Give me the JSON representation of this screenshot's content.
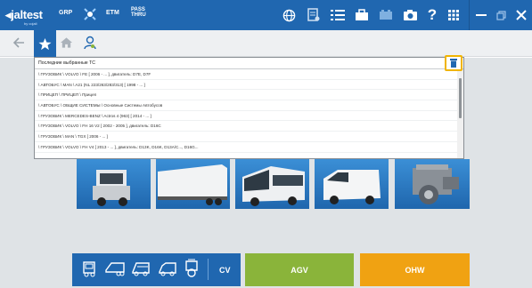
{
  "header": {
    "logo_prefix": "◂",
    "logo_text": "jaltest",
    "logo_sub": "by cojali",
    "nav": {
      "grp": "GRP",
      "etm": "ETM",
      "pass_line1": "PASS",
      "pass_line2": "THRU"
    },
    "icons": [
      "globe-icon",
      "document-icon",
      "list-icon",
      "briefcase-icon",
      "battery-icon",
      "camera-icon",
      "help-icon",
      "apps-grid-icon",
      "minimize-icon",
      "restore-icon",
      "close-icon"
    ]
  },
  "toolbar": {
    "back_icon": "arrow-left-icon",
    "tabs": [
      "star-icon",
      "home-icon",
      "user-icon"
    ]
  },
  "recent": {
    "title": "Последние выбранные ТС",
    "items": [
      "\\ ГРУЗОВИК \\ VOLVO \\ FE [ 2006 - ... ], двигатель: D7E, D7F",
      "\\ АВТОБУС \\ MAN \\ A21 (NL 223/263/283/313) [ 1998 - ... ]",
      "\\ ПРИЦЕП \\ ПРИЦЕП \\ Прицеп",
      "\\ АВТОБУС \\ ОБЩИЕ СИСТЕМЫ \\ Основные Системы Автобусов",
      "\\ ГРУЗОВИК \\ MERCEDES-BENZ \\ Actros 4 (963) [ 2014 - ... ]",
      "\\ ГРУЗОВИК \\ VOLVO \\ FH 16 V2 [ 2002 - 2005 ], двигатель: D16C",
      "\\ ГРУЗОВИК \\ MAN \\ TGX [ 2006 - ... ]",
      "\\ ГРУЗОВИК \\ VOLVO \\ FH V4 [ 2013 - ... ], двигатель: D13K, D16K, D13A/C..., D16G..."
    ]
  },
  "bottom": {
    "cv_label": "CV",
    "agv_label": "AGV",
    "ohw_label": "OHW",
    "agv_color": "#8ab43a",
    "ohw_color": "#f0a212",
    "brand_color": "#2067b0"
  }
}
